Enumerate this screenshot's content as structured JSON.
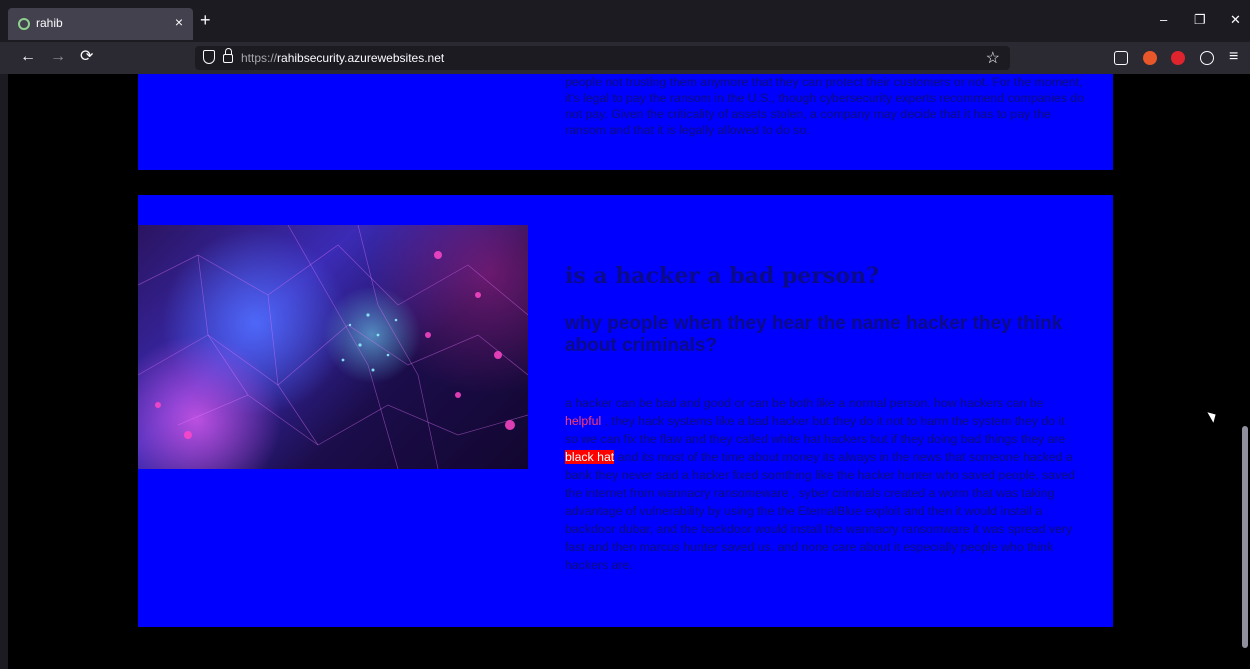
{
  "browser": {
    "tab_title": "rahib",
    "tab_close": "×",
    "new_tab": "+",
    "url_scheme": "https://",
    "url_host": "rahibsecurity.azurewebsites.net",
    "window_controls": {
      "minimize": "–",
      "restore": "❐",
      "close": "✕"
    },
    "nav": {
      "back": "←",
      "forward": "→",
      "reload": "⟳",
      "bookmark": "☆",
      "menu": "≡"
    }
  },
  "page": {
    "previous_section_text": "people not trusting them anymore that they can protect their customers or not. For the moment, it's legal to pay the ransom in the U.S., though cybersecurity experts recommend companies do not pay. Given the criticality of assets stolen, a company may decide that it has to pay the ransom and that it is legally allowed to do so.",
    "title": "is a hacker a bad person?",
    "subtitle": "why people when they hear the name hacker they think about criminals?",
    "body": {
      "p1": "a hacker can be bad and good or can be both like a normal person. how hackers can be ",
      "helpful": "helpful",
      "p2": " , they hack systems like a bad hacker but they do it not to harm the system they do it so we can fix the flaw and they called white hat hackers but if they doing bad things they are ",
      "black_hat": "black hat",
      "p3": " and its most of the time about money its always in the news that someone hacked a bank they never said a hacker fixed somthing like the hacker hunter who saved people, saved the internet from wannacry ransomeware , syber criminals created a worm that was taking advantage of vulnerability by using the the EternalBlue exploit and then it would install a backdoor dubar, and the backdoor would install the wannacry ransomware it was spread very fast and then marcus hunter saved us. and none care about it especially people who think hackers are."
    }
  },
  "colors": {
    "section_bg": "#0000ff",
    "text_dark": "#0b0b8a",
    "highlight_red": "#ff0000",
    "highlight_pink": "#ff3b6b"
  }
}
